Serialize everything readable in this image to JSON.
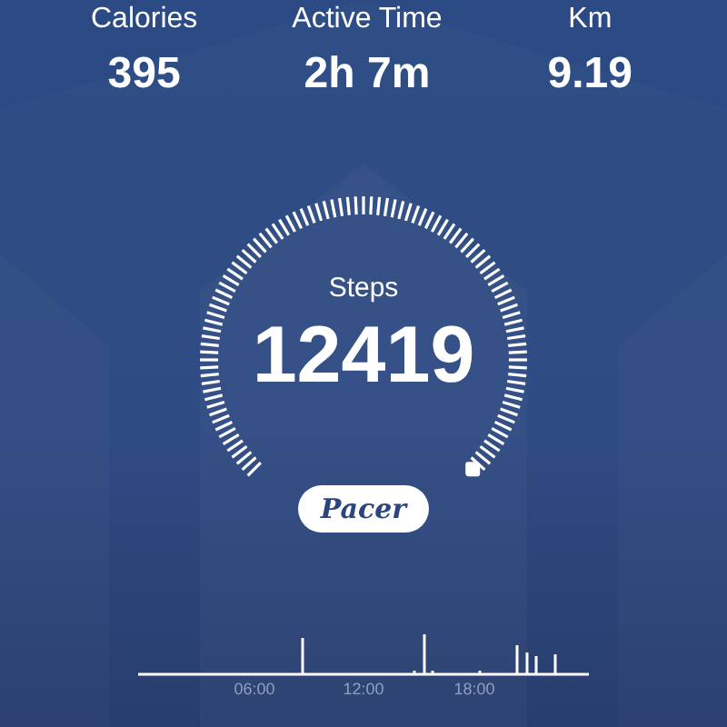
{
  "stats": [
    {
      "label": "Calories",
      "value": "395"
    },
    {
      "label": "Active Time",
      "value": "2h 7m"
    },
    {
      "label": "Km",
      "value": "9.19"
    }
  ],
  "gauge": {
    "label": "Steps",
    "value": "12419"
  },
  "logo": {
    "text": "Pacer"
  },
  "activity_chart": {
    "time_labels": [
      "06:00",
      "12:00",
      "18:00"
    ]
  }
}
